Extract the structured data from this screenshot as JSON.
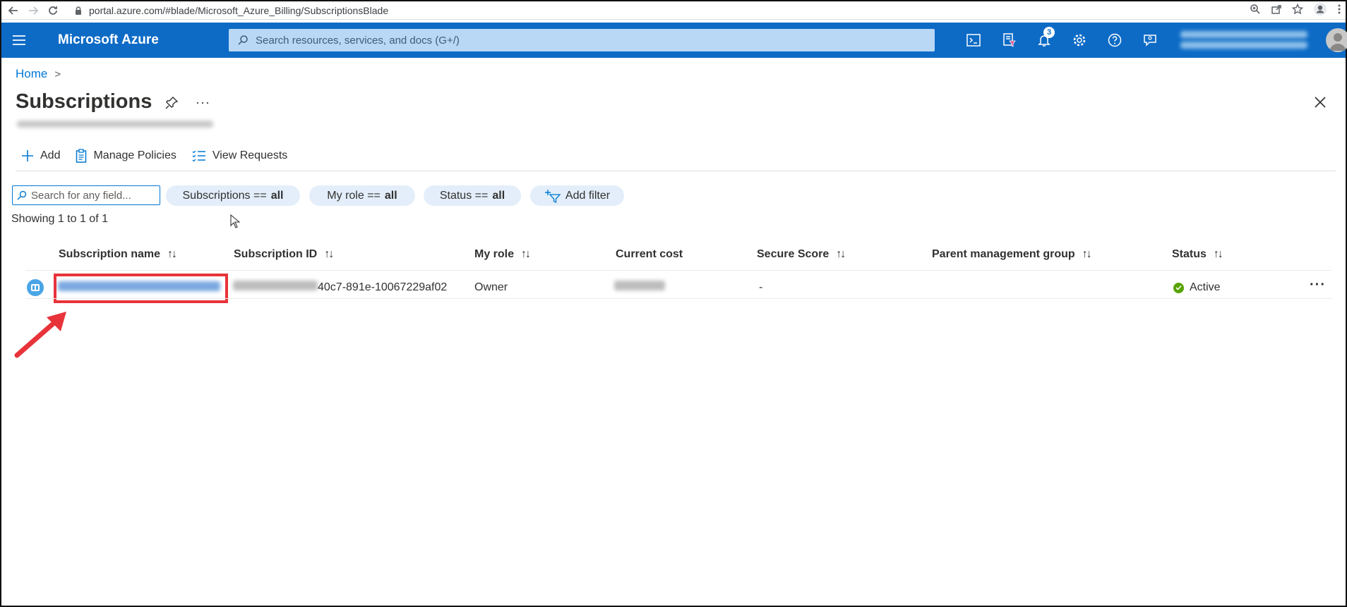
{
  "browser": {
    "url": "portal.azure.com/#blade/Microsoft_Azure_Billing/SubscriptionsBlade"
  },
  "topbar": {
    "brand": "Microsoft Azure",
    "search_placeholder": "Search resources, services, and docs (G+/)",
    "notification_count": "3"
  },
  "breadcrumb": {
    "home": "Home",
    "separator": ">"
  },
  "page": {
    "title": "Subscriptions",
    "more": "···"
  },
  "commands": {
    "add": "Add",
    "manage_policies": "Manage Policies",
    "view_requests": "View Requests"
  },
  "filters": {
    "search_placeholder": "Search for any field...",
    "subscriptions_label": "Subscriptions ==",
    "subscriptions_value": "all",
    "role_label": "My role ==",
    "role_value": "all",
    "status_label": "Status ==",
    "status_value": "all",
    "add_filter": "Add filter"
  },
  "results": {
    "showing": "Showing 1 to 1 of 1"
  },
  "table": {
    "columns": {
      "name": "Subscription name",
      "id": "Subscription ID",
      "role": "My role",
      "cost": "Current cost",
      "score": "Secure Score",
      "parent": "Parent management group",
      "status": "Status"
    },
    "sort_glyph": "↑↓",
    "rows": [
      {
        "id_suffix": "40c7-891e-10067229af02",
        "role": "Owner",
        "secure_score": "-",
        "status": "Active",
        "more": "···"
      }
    ]
  },
  "colors": {
    "azure_blue": "#0d6bc6",
    "link_blue": "#0078d4",
    "highlight_red": "#e8333a",
    "active_green": "#57a300"
  }
}
